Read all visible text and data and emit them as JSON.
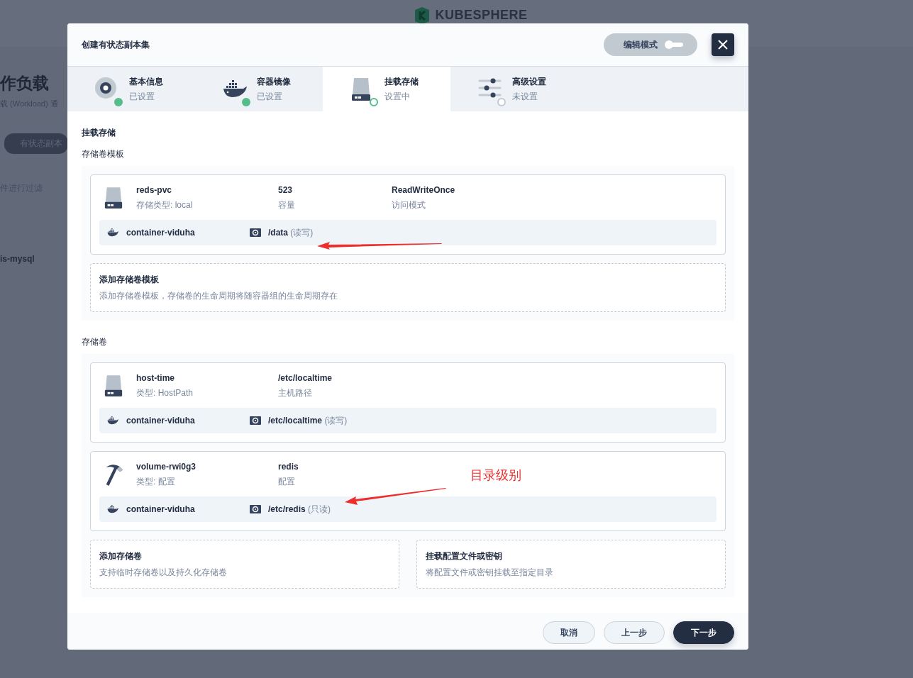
{
  "background": {
    "logo": "KUBESPHERE",
    "heading": "作负载",
    "subtitle": "载 (Workload) 通",
    "tab": "有状态副本",
    "filter": "件进行过滤",
    "row": "is-mysql"
  },
  "dialog": {
    "title": "创建有状态副本集",
    "edit_mode": {
      "label": "编辑模式",
      "on": false
    },
    "steps": [
      {
        "title": "基本信息",
        "status": "已设置",
        "done": true,
        "selected": false
      },
      {
        "title": "容器镜像",
        "status": "已设置",
        "done": true,
        "selected": false
      },
      {
        "title": "挂载存储",
        "status": "设置中",
        "done": false,
        "selected": true
      },
      {
        "title": "高级设置",
        "status": "未设置",
        "done": false,
        "selected": false
      }
    ],
    "section_title": "挂载存储",
    "groups": [
      {
        "title": "存储卷模板",
        "volumes": [
          {
            "kind": "disk",
            "name": "reds-pvc",
            "type": "存储类型: local",
            "fields": [
              {
                "value": "523",
                "label": "容量"
              },
              {
                "value": "ReadWriteOnce",
                "label": "访问模式"
              }
            ],
            "mounts": [
              {
                "container": "container-viduha",
                "path": "/data",
                "mode": "(读写)"
              }
            ]
          }
        ],
        "add_cards": [
          {
            "title": "添加存储卷模板",
            "description": "添加存储卷模板，存储卷的生命周期将随容器组的生命周期存在"
          }
        ]
      },
      {
        "title": "存储卷",
        "volumes": [
          {
            "kind": "disk",
            "name": "host-time",
            "type": "类型: HostPath",
            "fields": [
              {
                "value": "/etc/localtime",
                "label": "主机路径"
              }
            ],
            "mounts": [
              {
                "container": "container-viduha",
                "path": "/etc/localtime",
                "mode": "(读写)"
              }
            ]
          },
          {
            "kind": "hammer",
            "name": "volume-rwi0g3",
            "type": "类型: 配置",
            "fields": [
              {
                "value": "redis",
                "label": "配置"
              }
            ],
            "mounts": [
              {
                "container": "container-viduha",
                "path": "/etc/redis",
                "mode": "(只读)"
              }
            ]
          }
        ],
        "add_cards": [
          {
            "title": "添加存储卷",
            "description": "支持临时存储卷以及持久化存储卷"
          },
          {
            "title": "挂载配置文件或密钥",
            "description": "将配置文件或密钥挂载至指定目录"
          }
        ]
      }
    ],
    "buttons": [
      {
        "label": "取消",
        "kind": "secondary"
      },
      {
        "label": "上一步",
        "kind": "secondary"
      },
      {
        "label": "下一步",
        "kind": "primary"
      }
    ]
  },
  "annotation": {
    "text": "目录级别"
  }
}
